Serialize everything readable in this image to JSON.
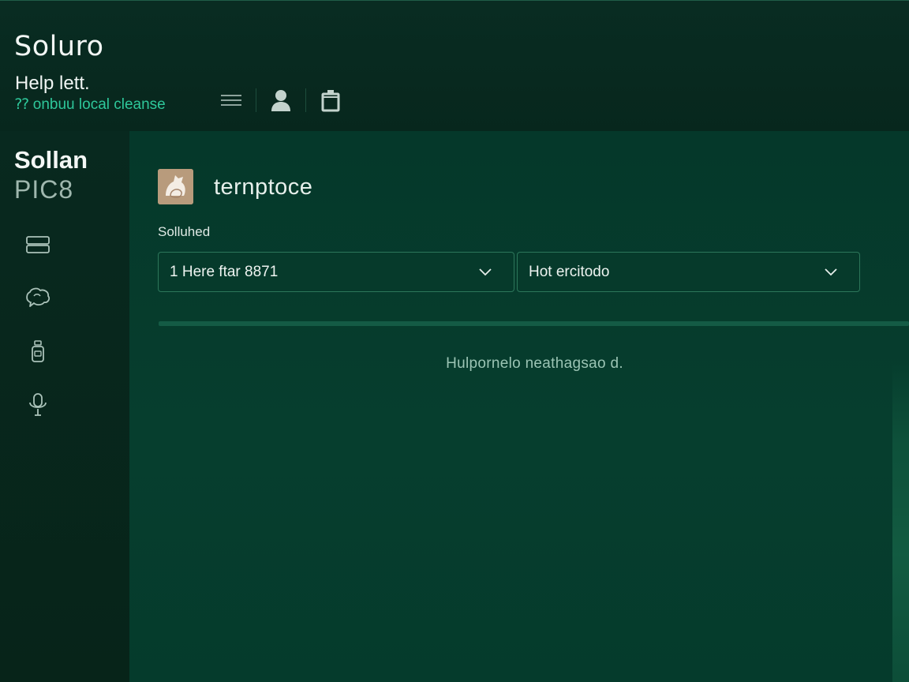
{
  "header": {
    "logo": "Soluro",
    "help_title": "Help lett.",
    "help_subtitle": "⁇ onbuu local cleanse",
    "icons": [
      "menu-icon",
      "user-icon",
      "trash-icon"
    ]
  },
  "sidebar": {
    "title": "Sollan",
    "subtitle": "PIC8",
    "items": [
      {
        "icon": "server-icon"
      },
      {
        "icon": "chat-icon"
      },
      {
        "icon": "bottle-icon"
      },
      {
        "icon": "microphone-icon"
      }
    ]
  },
  "main": {
    "title": "ternptoce",
    "field_label": "Solluhed",
    "select_1": {
      "value": "1 Here ftar 8871"
    },
    "select_2": {
      "value": "Hot ercitodo"
    },
    "empty_message": "Hulpornelo neathagsao d."
  },
  "colors": {
    "background": "#07281d",
    "main_panel": "#063e2e",
    "accent": "#2ec79a",
    "border": "#2c765a"
  }
}
